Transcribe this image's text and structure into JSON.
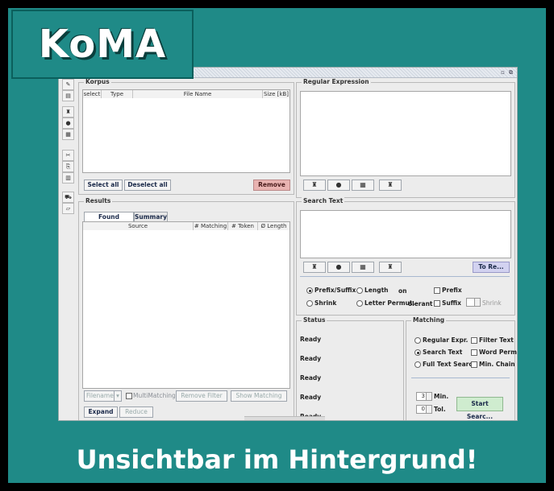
{
  "logo": "KoMA",
  "tagline": "Unsichtbar im Hintergrund!",
  "window": {
    "ctrl_restore": "▫",
    "ctrl_max": "⧉"
  },
  "toolbar": {
    "icons": [
      "✎",
      "▤",
      "♜",
      "●",
      "▦",
      "✂",
      "⎘",
      "▥",
      "⛟",
      "▱"
    ]
  },
  "korpus": {
    "title": "Korpus",
    "columns": [
      "select",
      "Type",
      "File Name",
      "Size [kB]"
    ],
    "select_all": "Select all",
    "deselect_all": "Deselect all",
    "remove": "Remove"
  },
  "regex": {
    "title": "Regular Expression",
    "icons": [
      "♜",
      "●",
      "▦",
      "♜"
    ]
  },
  "results": {
    "title": "Results",
    "tabs": [
      "Found Matching",
      "Summary"
    ],
    "columns": [
      "Source",
      "# Matching",
      "# Token",
      "Ø Length"
    ],
    "filter_placeholder": "Filename",
    "multimatching": "MultiMatching",
    "remove_filter": "Remove Filter",
    "show_matching": "Show Matching",
    "expand": "Expand",
    "reduce": "Reduce"
  },
  "search_text": {
    "title": "Search Text",
    "icons": [
      "♜",
      "●",
      "▦",
      "♜"
    ],
    "to_re": "To Re...",
    "prefix_suffix": "Prefix/Suffix",
    "length": "Length",
    "on": "on",
    "prefix": "Prefix",
    "shrink": "Shrink",
    "letter_permut": "Letter Permut.",
    "tolerant": "olerant",
    "suffix": "Suffix",
    "shrink_num": "Shrink"
  },
  "status": {
    "title": "Status",
    "lines": [
      "Ready",
      "Ready",
      "Ready",
      "Ready",
      "Ready"
    ]
  },
  "matching": {
    "title": "Matching",
    "regular_expr": "Regular Expr.",
    "filter_text": "Filter Text",
    "search_text": "Search Text",
    "word_perm": "Word Perm•",
    "full_text_search": "Full Text Search",
    "min_chain": "Min. Chain",
    "min_value": "3",
    "min_label": "Min.",
    "tol_value": "0",
    "tol_label": "Tol.",
    "start_search": "Start Searc..."
  }
}
